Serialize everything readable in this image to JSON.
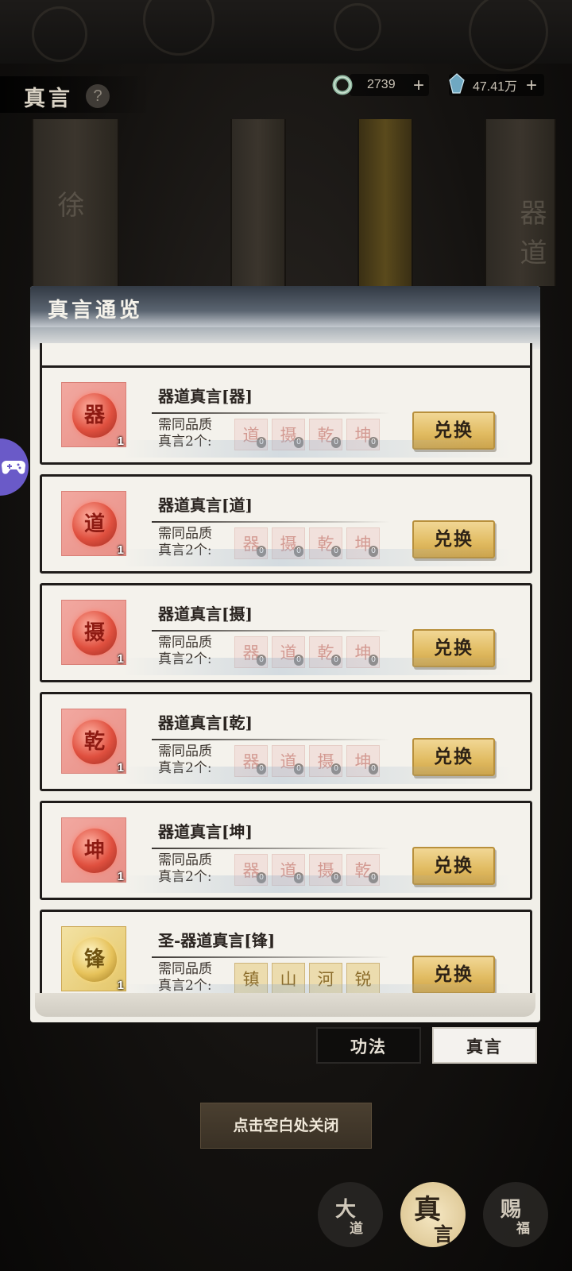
{
  "header": {
    "title": "真言",
    "help": "?"
  },
  "currency": [
    {
      "icon": "jade-ring-icon",
      "value": "2739"
    },
    {
      "icon": "blue-crystal-icon",
      "value": "47.41万"
    }
  ],
  "background_glyphs": [
    "器",
    "道",
    "徐"
  ],
  "dialog": {
    "title": "真言通览",
    "req_label": "需同品质\n真言2个:",
    "exchange_label": "兑换",
    "items": [
      {
        "name": "器道真言[器]",
        "glyph": "器",
        "count": "1",
        "quality": "red",
        "reqs": [
          {
            "glyph": "道",
            "count": "0"
          },
          {
            "glyph": "摄",
            "count": "0"
          },
          {
            "glyph": "乾",
            "count": "0"
          },
          {
            "glyph": "坤",
            "count": "0"
          }
        ]
      },
      {
        "name": "器道真言[道]",
        "glyph": "道",
        "count": "1",
        "quality": "red",
        "reqs": [
          {
            "glyph": "器",
            "count": "0"
          },
          {
            "glyph": "摄",
            "count": "0"
          },
          {
            "glyph": "乾",
            "count": "0"
          },
          {
            "glyph": "坤",
            "count": "0"
          }
        ]
      },
      {
        "name": "器道真言[摄]",
        "glyph": "摄",
        "count": "1",
        "quality": "red",
        "reqs": [
          {
            "glyph": "器",
            "count": "0"
          },
          {
            "glyph": "道",
            "count": "0"
          },
          {
            "glyph": "乾",
            "count": "0"
          },
          {
            "glyph": "坤",
            "count": "0"
          }
        ]
      },
      {
        "name": "器道真言[乾]",
        "glyph": "乾",
        "count": "1",
        "quality": "red",
        "reqs": [
          {
            "glyph": "器",
            "count": "0"
          },
          {
            "glyph": "道",
            "count": "0"
          },
          {
            "glyph": "摄",
            "count": "0"
          },
          {
            "glyph": "坤",
            "count": "0"
          }
        ]
      },
      {
        "name": "器道真言[坤]",
        "glyph": "坤",
        "count": "1",
        "quality": "red",
        "reqs": [
          {
            "glyph": "器",
            "count": "0"
          },
          {
            "glyph": "道",
            "count": "0"
          },
          {
            "glyph": "摄",
            "count": "0"
          },
          {
            "glyph": "乾",
            "count": "0"
          }
        ]
      },
      {
        "name": "圣-器道真言[锋]",
        "glyph": "锋",
        "count": "1",
        "quality": "gold",
        "reqs": [
          {
            "glyph": "镇",
            "count": ""
          },
          {
            "glyph": "山",
            "count": ""
          },
          {
            "glyph": "河",
            "count": ""
          },
          {
            "glyph": "锐",
            "count": ""
          }
        ]
      }
    ]
  },
  "tabs": {
    "gongfa": "功法",
    "zhenyan": "真言"
  },
  "close_hint": "点击空白处关闭",
  "bottom_nav": [
    {
      "main": "大",
      "sub": "道"
    },
    {
      "main": "真",
      "sub": "言"
    },
    {
      "main": "赐",
      "sub": "福"
    }
  ]
}
